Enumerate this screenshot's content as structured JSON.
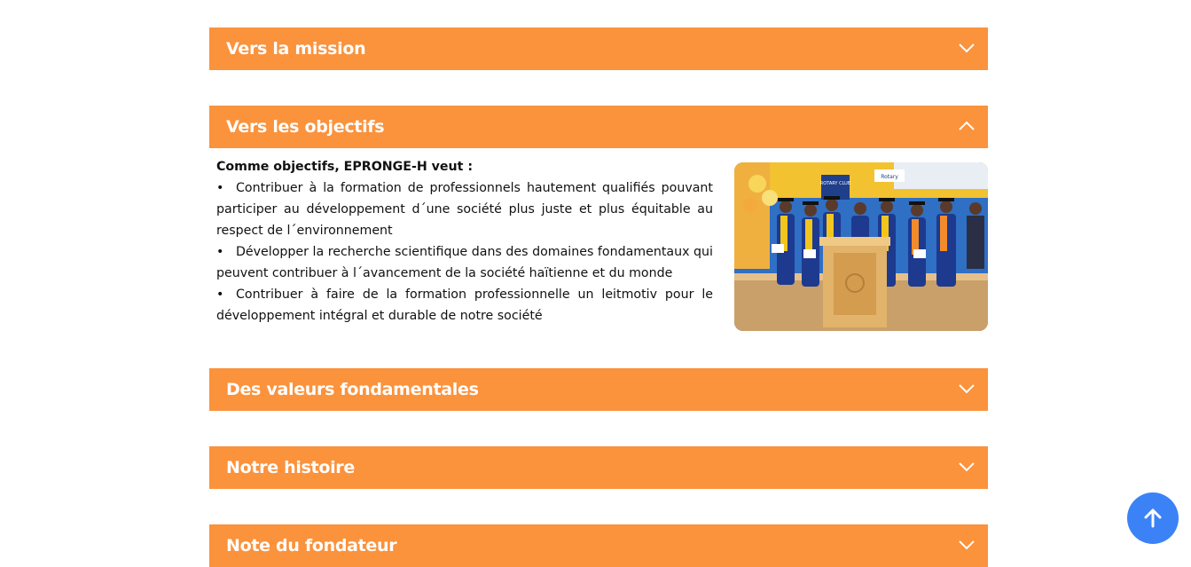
{
  "accordion": {
    "items": [
      {
        "label": "Vers la mission",
        "expanded": false
      },
      {
        "label": "Vers les objectifs",
        "expanded": true
      },
      {
        "label": "Des valeurs fondamentales",
        "expanded": false
      },
      {
        "label": "Notre histoire",
        "expanded": false
      },
      {
        "label": "Note du fondateur",
        "expanded": false
      }
    ]
  },
  "objectifs": {
    "lead": "Comme objectifs, EPRONGE-H veut :",
    "bullets": [
      "Contribuer à la formation de professionnels hautement qualifiés pouvant participer au développement d´une société plus juste et plus équitable au respect de l´environnement",
      "Développer la recherche scientifique dans des domaines fondamentaux qui peuvent contribuer à l´avancement de la société haïtienne et du monde",
      "Contribuer à faire de la formation professionnelle un leitmotiv pour le développement intégral et durable de notre société"
    ],
    "bullet_glyph": "•",
    "image_banner_text": "ROTARY CLUB",
    "image_sign_text": "Rotary"
  },
  "icons": {
    "collapsed": "chevron-down-icon",
    "expanded": "chevron-up-icon",
    "scroll_top": "arrow-up-icon"
  },
  "colors": {
    "header_bg": "#fb923c",
    "scroll_button": "#3b82f6"
  }
}
